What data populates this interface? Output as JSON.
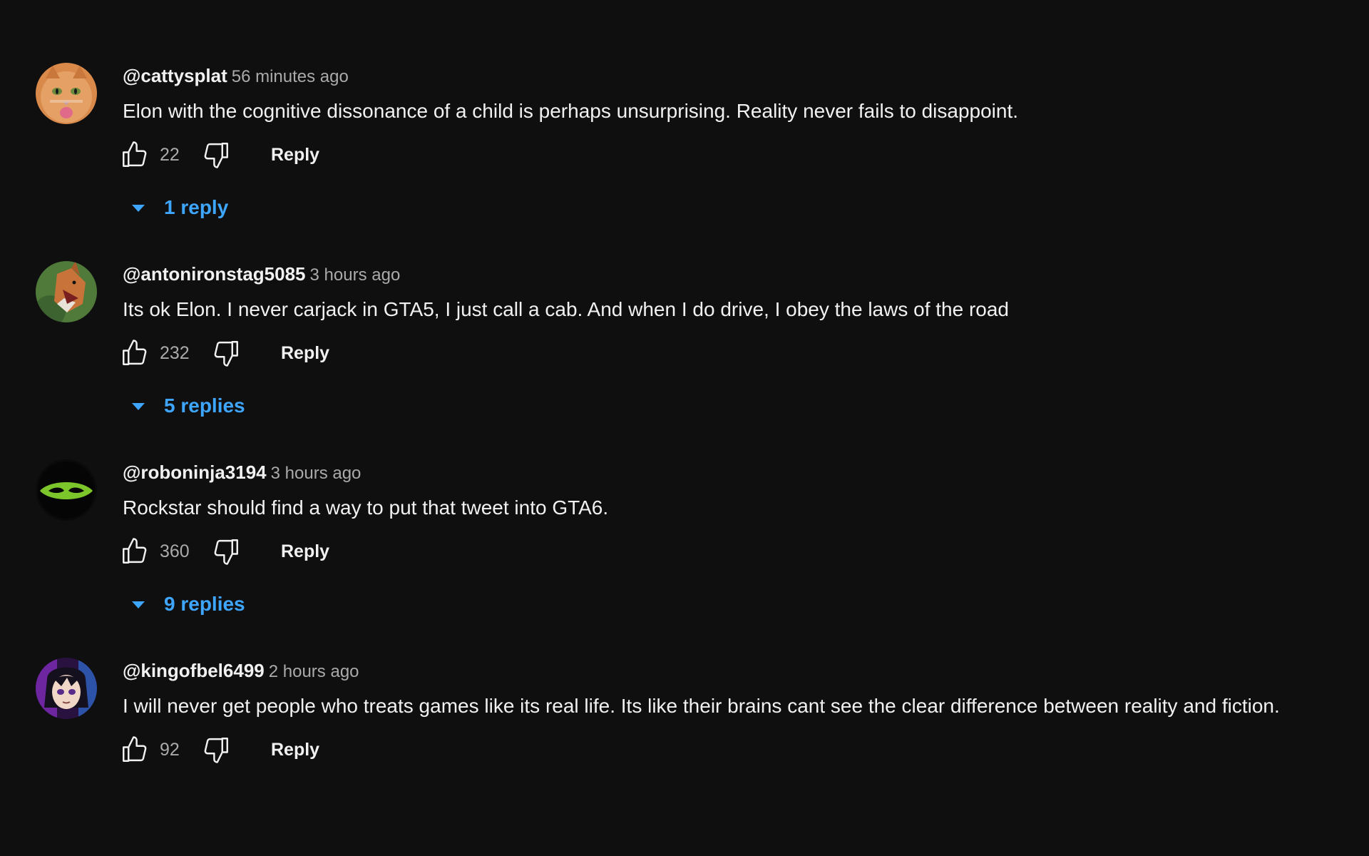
{
  "comments": [
    {
      "author": "@cattysplat",
      "time": "56 minutes ago",
      "text": "Elon with the cognitive dissonance of a child is perhaps unsurprising. Reality never fails to disappoint.",
      "likes": "22",
      "reply_label": "Reply",
      "replies_label": "1 reply"
    },
    {
      "author": "@antonironstag5085",
      "time": "3 hours ago",
      "text": "Its ok Elon. I never carjack in GTA5, I just call a cab. And when I do drive, I obey the laws of the road",
      "likes": "232",
      "reply_label": "Reply",
      "replies_label": "5 replies"
    },
    {
      "author": "@roboninja3194",
      "time": "3 hours ago",
      "text": "Rockstar should find a way to put that tweet into GTA6.",
      "likes": "360",
      "reply_label": "Reply",
      "replies_label": "9 replies"
    },
    {
      "author": "@kingofbel6499",
      "time": "2 hours ago",
      "text": "I will never get people who treats games like its real life. Its like their brains cant see the clear difference between reality and fiction.",
      "likes": "92",
      "reply_label": "Reply"
    }
  ],
  "colors": {
    "background": "#0f0f0f",
    "primary_text": "#f1f1f1",
    "secondary_text": "#aaaaaa",
    "link_blue": "#3ea6ff"
  },
  "icons": {
    "like": "thumbs-up-icon",
    "dislike": "thumbs-down-icon",
    "expand": "caret-down-icon"
  }
}
